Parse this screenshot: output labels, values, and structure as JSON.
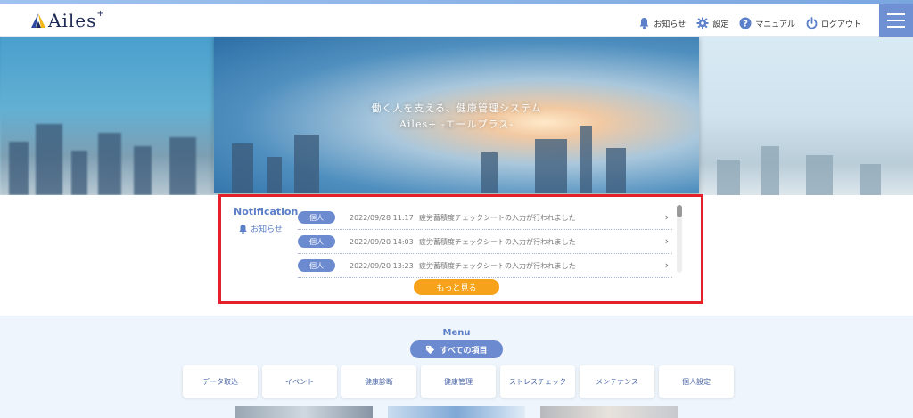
{
  "header": {
    "logo_text": "Ailes",
    "logo_plus": "+",
    "nav": [
      {
        "label": "お知らせ",
        "icon": "bell-icon"
      },
      {
        "label": "設定",
        "icon": "gear-icon"
      },
      {
        "label": "マニュアル",
        "icon": "help-icon"
      },
      {
        "label": "ログアウト",
        "icon": "power-icon"
      }
    ]
  },
  "hero": {
    "title": "働く人を支える、健康管理システム",
    "subtitle": "Ailes+ -エールプラス-"
  },
  "notification": {
    "title": "Notification",
    "subtitle": "お知らせ",
    "items": [
      {
        "badge": "個人",
        "date": "2022/09/28 11:17",
        "text": "疲労蓄積度チェックシートの入力が行われました"
      },
      {
        "badge": "個人",
        "date": "2022/09/20 14:03",
        "text": "疲労蓄積度チェックシートの入力が行われました"
      },
      {
        "badge": "個人",
        "date": "2022/09/20 13:23",
        "text": "疲労蓄積度チェックシートの入力が行われました"
      }
    ],
    "more_label": "もっと見る"
  },
  "menu": {
    "title": "Menu",
    "all_label": "すべての項目",
    "items": [
      "データ取込",
      "イベント",
      "健康診断",
      "健康管理",
      "ストレスチェック",
      "メンテナンス",
      "個人設定"
    ]
  },
  "colors": {
    "accent": "#6b8ad0",
    "highlight": "#e3212b",
    "button_orange": "#f6a21a",
    "menu_bg": "#eef5fc"
  }
}
